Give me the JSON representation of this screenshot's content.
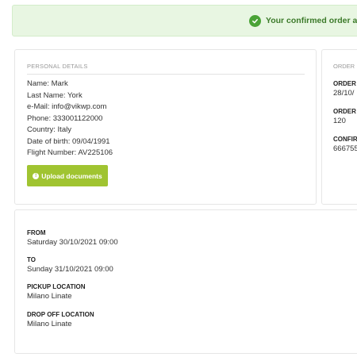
{
  "alert": {
    "text": "Your confirmed order at Vi",
    "icon": "check-circle-icon",
    "color": "#4aa336"
  },
  "personal": {
    "title": "PERSONAL DETAILS",
    "lines": [
      "Name: Mark",
      "Last Name: York",
      "e-Mail: info@vikwp.com",
      "Phone: 333001122000",
      "Country: Italy",
      "Date of birth: 09/04/1991",
      "Flight Number: AV225106"
    ],
    "upload_label": "Upload documents",
    "upload_icon": "info-icon",
    "upload_color": "#a0c431"
  },
  "order": {
    "title": "ORDER",
    "fields": [
      {
        "label": "ORDER",
        "value": "28/10/"
      },
      {
        "label": "ORDER",
        "value": "120"
      },
      {
        "label": "CONFIR",
        "value": "666755"
      }
    ]
  },
  "trip": {
    "from_label": "FROM",
    "from_value": "Saturday 30/10/2021 09:00",
    "to_label": "TO",
    "to_value": "Sunday 31/10/2021 09:00",
    "pickup_label": "PICKUP LOCATION",
    "pickup_value": "Milano Linate",
    "dropoff_label": "DROP OFF LOCATION",
    "dropoff_value": "Milano Linate"
  }
}
